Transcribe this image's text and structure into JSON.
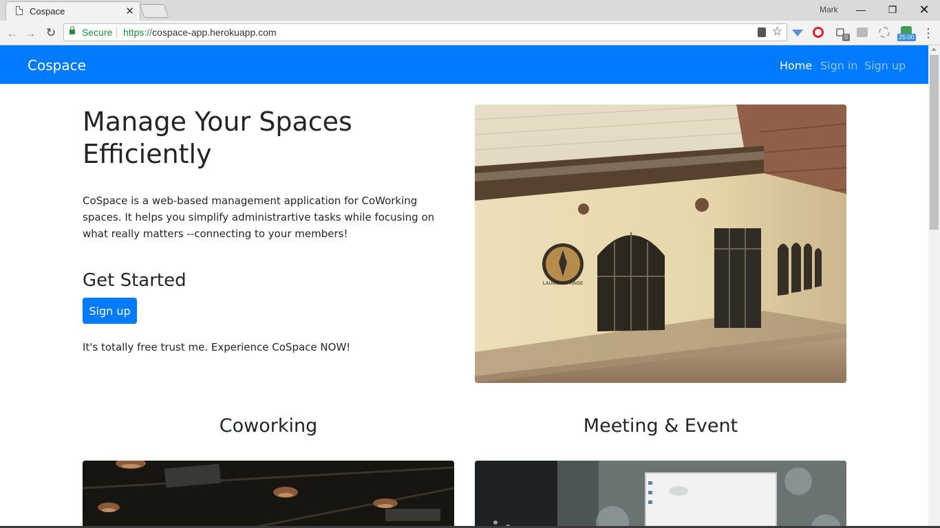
{
  "browser": {
    "tab_title": "Cospace",
    "user_name": "Mark",
    "secure_label": "Secure",
    "url_scheme": "https://",
    "url_host": "cospace-app.herokuapp.com",
    "extension_badges": [
      "0",
      "25:00"
    ]
  },
  "navbar": {
    "brand": "Cospace",
    "links": [
      "Home",
      "Sign in",
      "Sign up"
    ],
    "color": "#007bff"
  },
  "hero": {
    "title_line1": "Manage Your Spaces",
    "title_line2": "Efficiently",
    "description": "CoSpace is a web-based management application for CoWorking spaces. It helps you simplify administrartive tasks while focusing on what really matters --connecting to your members!",
    "get_started": "Get Started",
    "signup_button": "Sign up",
    "free_text": "It's totally free trust me. Experience CoSpace NOW!",
    "image_sign_text": "LAUNCHGARAGE"
  },
  "sections": [
    "Coworking",
    "Meeting & Event"
  ]
}
